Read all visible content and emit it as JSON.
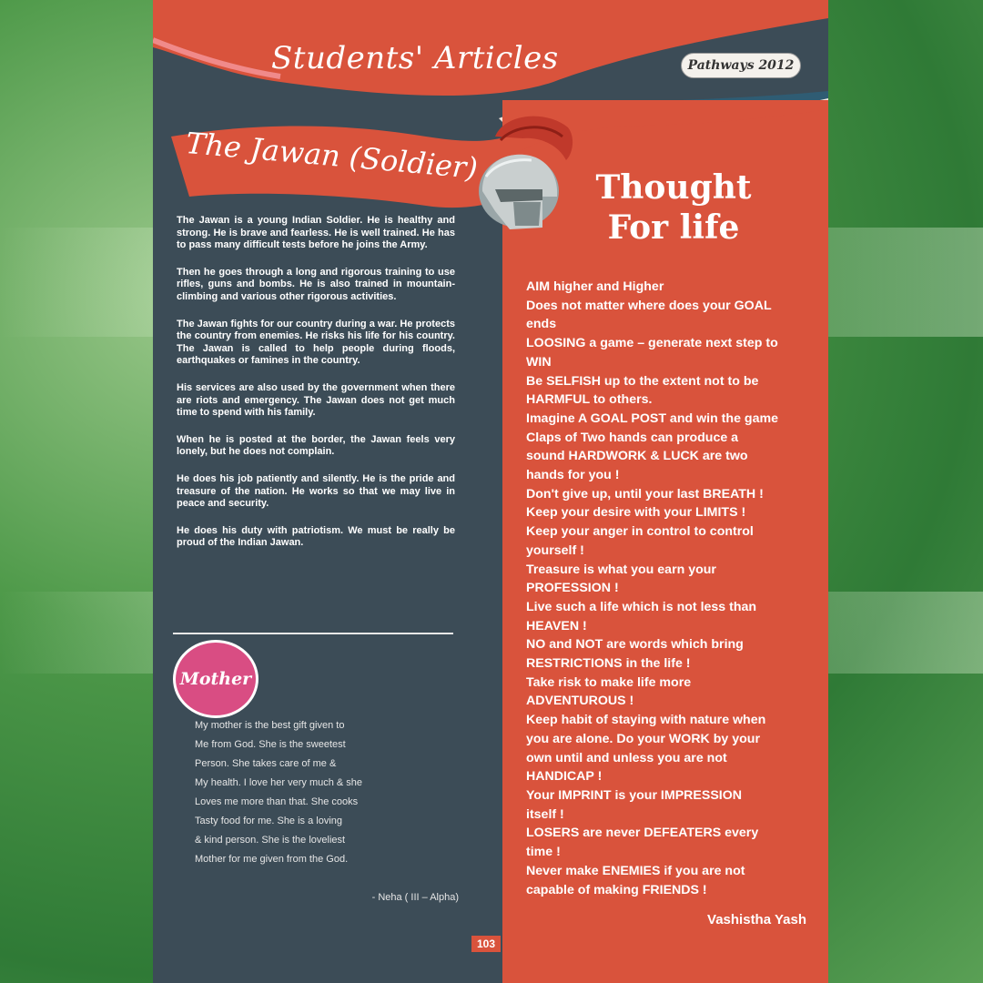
{
  "header": {
    "section_title": "Students' Articles",
    "badge": "Pathways 2012"
  },
  "article": {
    "title": "The Jawan (Soldier)",
    "paragraphs": [
      "The Jawan is a young Indian Soldier. He is healthy and strong. He is brave and fearless. He is well trained. He has to pass many difficult tests before he joins the Army.",
      "Then he goes through a long and rigorous training to use rifles, guns and bombs. He is also trained in mountain- climbing and various other rigorous activities.",
      "The Jawan fights for our country during a war. He protects the country from enemies. He risks his life for his country. The Jawan is called to help people during floods, earthquakes or famines in the country.",
      "His services are also used by the government when there are riots and emergency. The Jawan does not get much time to spend with his family.",
      "When he is posted at the border, the Jawan feels very lonely, but he does not complain.",
      "He does his job patiently and silently. He is the pride and treasure of the nation. He works so that we may live in peace and security.",
      "He does his duty with patriotism. We must be really be proud of the Indian Jawan."
    ]
  },
  "poem": {
    "title": "Mother",
    "lines": [
      "My mother is the best gift given to",
      "Me from God. She is the sweetest",
      "Person. She takes care of me &",
      "My health. I love her very much & she",
      "Loves me more than that. She cooks",
      "Tasty food for me. She is a loving",
      "& kind person. She is the loveliest",
      "Mother for me given from the God."
    ],
    "author": "- Neha ( III – Alpha)"
  },
  "thought": {
    "title_line1": "Thought",
    "title_line2": "For life",
    "lines": [
      "AIM higher and Higher",
      "Does not matter where does your GOAL",
      "ends",
      "LOOSING a game – generate next step to",
      "WIN",
      "Be SELFISH up to the extent not to be",
      "HARMFUL to others.",
      "Imagine A GOAL POST and win the game",
      "Claps of Two hands can produce a",
      "sound HARDWORK & LUCK are two",
      "hands for you !",
      "Don't give up, until your last BREATH !",
      "Keep your desire with your LIMITS !",
      "Keep your anger in control to control",
      "yourself !",
      "Treasure is what you earn your",
      "PROFESSION !",
      "Live such a life which is not less than",
      "HEAVEN !",
      "NO and NOT are words which bring",
      "RESTRICTIONS in the life !",
      "Take risk to make life more",
      "ADVENTUROUS !",
      "Keep habit of staying with nature when",
      "you are alone. Do your WORK by your",
      "own until and unless you are not",
      "HANDICAP !",
      "Your IMPRINT is your IMPRESSION",
      "itself !",
      "LOSERS are never DEFEATERS every",
      "time !",
      "Never make ENEMIES if you are not",
      "capable of making FRIENDS !"
    ],
    "author": "Vashistha Yash"
  },
  "page_number": "103",
  "colors": {
    "accent_red": "#d9533c",
    "panel_slate": "#3c4c57",
    "mother_pink": "#d94d83",
    "background_green": "#3f8a3f"
  },
  "icons": {
    "helmet": "roman-helmet-icon"
  }
}
